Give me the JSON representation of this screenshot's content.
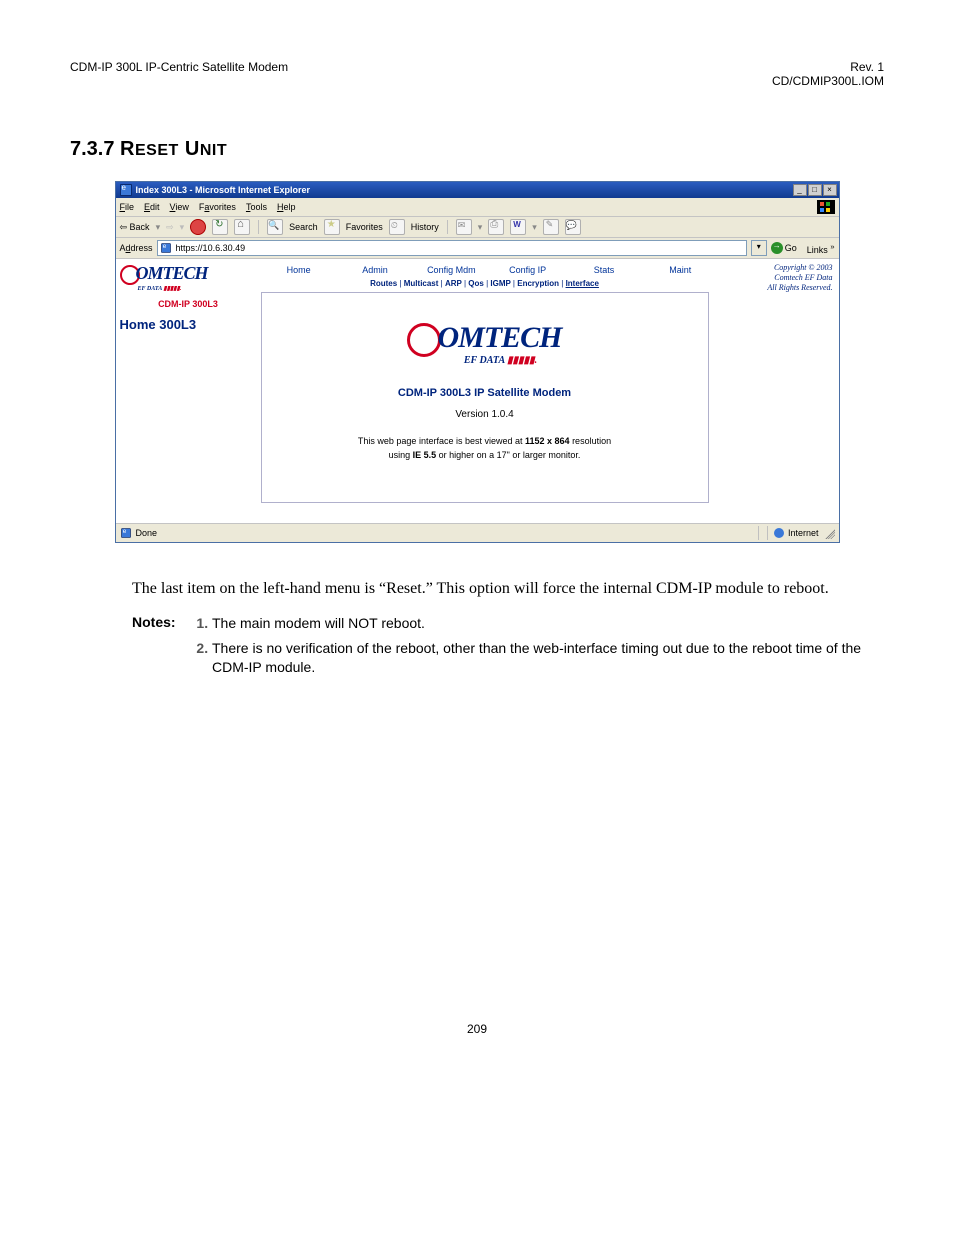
{
  "header": {
    "left": "CDM-IP 300L IP-Centric Satellite Modem",
    "right_line1": "Rev. 1",
    "right_line2": "CD/CDMIP300L.IOM"
  },
  "section": {
    "number": "7.3.7",
    "title_word1": "R",
    "title_rest1": "ESET",
    "title_word2": "U",
    "title_rest2": "NIT"
  },
  "screenshot": {
    "titlebar": "Index 300L3 - Microsoft Internet Explorer",
    "win_min": "_",
    "win_max": "□",
    "win_close": "×",
    "menu": {
      "file": "File",
      "edit": "Edit",
      "view": "View",
      "favorites": "Favorites",
      "tools": "Tools",
      "help": "Help"
    },
    "toolbar": {
      "back": "Back",
      "search": "Search",
      "favorites": "Favorites",
      "history": "History"
    },
    "address_label": "Address",
    "address_value": "https://10.6.30.49",
    "go": "Go",
    "links": "Links",
    "left_panel": {
      "brand_main": "OMTECH",
      "brand_sub_prefix": "EF DATA",
      "model": "CDM-IP 300L3",
      "home": "Home 300L3"
    },
    "nav": {
      "home": "Home",
      "admin": "Admin",
      "config_mdm": "Config Mdm",
      "config_ip": "Config IP",
      "stats": "Stats",
      "maint": "Maint"
    },
    "subnav": {
      "routes": "Routes",
      "multicast": "Multicast",
      "arp": "ARP",
      "qos": "Qos",
      "igmp": "IGMP",
      "encryption": "Encryption",
      "interface": "Interface"
    },
    "copyright": {
      "line1": "Copyright © 2003",
      "line2": "Comtech EF Data",
      "line3": "All Rights Reserved."
    },
    "panel": {
      "title": "CDM-IP 300L3 IP Satellite Modem",
      "version": "Version 1.0.4",
      "note_before": "This web page interface is best viewed at ",
      "note_bold": "1152 x 864",
      "note_after": " resolution",
      "note_line2_before": "using ",
      "note_line2_bold": "IE 5.5",
      "note_line2_after": " or higher on a 17\" or larger monitor."
    },
    "status": {
      "done": "Done",
      "zone": "Internet"
    }
  },
  "body_para": "The last item on the left-hand menu is “Reset.” This option will force the internal CDM-IP module to reboot.",
  "notes_label": "Notes:",
  "notes": {
    "n1": "The main modem will NOT reboot.",
    "n2": "There is no verification of the reboot, other than the web-interface timing out due to the reboot time of the CDM-IP module."
  },
  "page_number": "209"
}
